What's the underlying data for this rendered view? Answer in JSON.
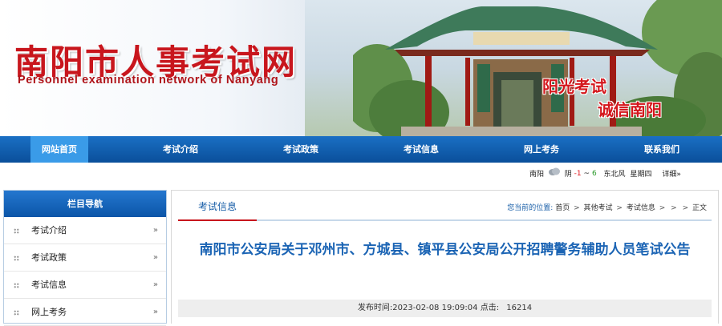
{
  "header": {
    "site_title": "南阳市人事考试网",
    "site_subtitle": "Personnel examination network of Nanyang",
    "slogan_line1": "阳光考试",
    "slogan_line2": "诚信南阳"
  },
  "nav": {
    "items": [
      {
        "label": "网站首页",
        "active": true
      },
      {
        "label": "考试介绍"
      },
      {
        "label": "考试政策"
      },
      {
        "label": "考试信息"
      },
      {
        "label": "网上考务"
      },
      {
        "label": "联系我们"
      }
    ]
  },
  "weather": {
    "city": "南阳",
    "condition": "阴",
    "temp_low": "-1",
    "temp_sep": "~",
    "temp_high": "6",
    "wind": "东北风",
    "day": "星期四",
    "details": "详细»"
  },
  "sidebar": {
    "title": "栏目导航",
    "items": [
      {
        "label": "考试介绍",
        "arrow": "»"
      },
      {
        "label": "考试政策",
        "arrow": "»"
      },
      {
        "label": "考试信息",
        "arrow": "»"
      },
      {
        "label": "网上考务",
        "arrow": "»"
      }
    ]
  },
  "main": {
    "tab_label": "考试信息",
    "breadcrumb": {
      "prefix": "您当前的位置:",
      "items": [
        "首页",
        "其他考试",
        "考试信息",
        "",
        "正文"
      ],
      "separator": ">"
    },
    "article": {
      "title": "南阳市公安局关于邓州市、方城县、镇平县公安局公开招聘警务辅助人员笔试公告",
      "published_label": "发布时间:",
      "published": "2023-02-08 19:09:04",
      "views_label": "点击:",
      "views": "16214"
    }
  },
  "colors": {
    "brand_red": "#c8161d",
    "nav_blue": "#0a4f9a",
    "nav_active": "#3a9be8",
    "title_blue": "#1b64b4"
  }
}
